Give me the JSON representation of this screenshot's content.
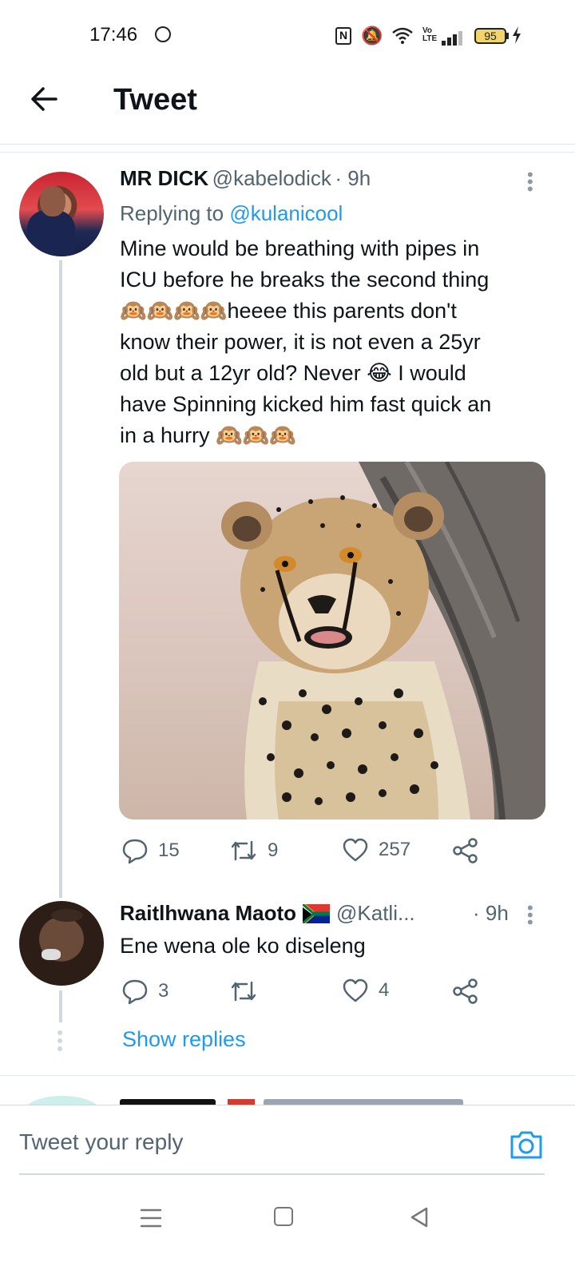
{
  "status_bar": {
    "time": "17:46",
    "battery": "95",
    "network": "Vo LTE",
    "icons": [
      "whatsapp-icon",
      "nfc-icon",
      "mute-icon",
      "wifi-icon",
      "signal-icon",
      "battery-icon",
      "charging-icon"
    ]
  },
  "header": {
    "title": "Tweet",
    "back_icon": "arrow-left-icon"
  },
  "tweets": [
    {
      "display_name": "MR DICK",
      "handle": "@kabelodick",
      "time": "· 9h",
      "replying_prefix": "Replying to",
      "replying_to": "@kulanicool",
      "text_lines": [
        "Mine would be breathing with pipes in",
        "ICU before he breaks the second thing",
        "🙉🙉🙉🙉heeee this parents don't",
        "know their power, it is not even a 25yr",
        "old but a 12yr old? Never 😂 I would",
        "have Spinning kicked him fast quick an",
        "in a hurry 🙉🙉🙉"
      ],
      "media": "cheetah-photo",
      "actions": {
        "replies": "15",
        "retweets": "9",
        "likes": "257"
      }
    },
    {
      "display_name": "Raitlhwana Maoto",
      "flag": "south-africa-flag",
      "handle": "@Katli...",
      "time": "· 9h",
      "text": "Ene wena ole ko diseleng",
      "actions": {
        "replies": "3",
        "retweets": "",
        "likes": "4"
      },
      "show_replies": "Show replies"
    }
  ],
  "reply_bar": {
    "placeholder": "Tweet your reply",
    "camera_icon": "camera-icon"
  },
  "nav_bar": [
    "menu-icon",
    "home-icon",
    "back-icon"
  ],
  "colors": {
    "accent": "#1d9bf0",
    "text_primary": "#0f1419",
    "text_secondary": "#536471",
    "divider": "#cfd9de"
  }
}
